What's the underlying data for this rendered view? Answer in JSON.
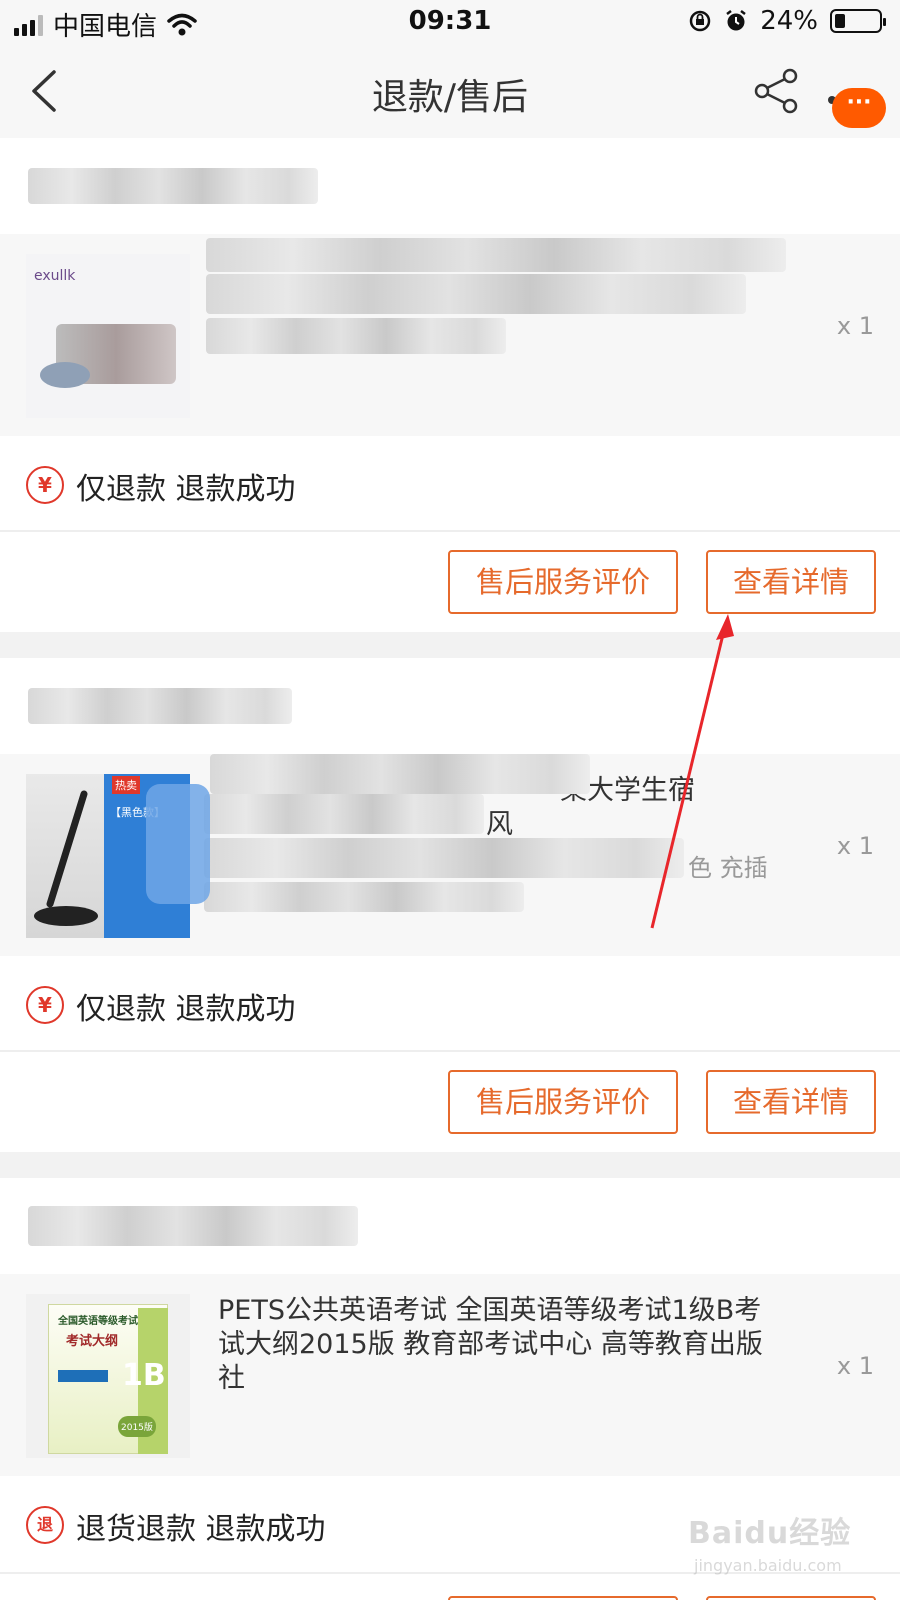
{
  "status_bar": {
    "carrier": "中国电信",
    "time": "09:31",
    "battery": "24%",
    "battery_level": 0.24,
    "icons": [
      "signal-icon",
      "wifi-icon",
      "rotation-lock-icon",
      "alarm-icon",
      "battery-icon"
    ]
  },
  "nav": {
    "title": "退款/售后",
    "message_badge": "···",
    "icons": [
      "back-icon",
      "share-icon",
      "more-icon"
    ]
  },
  "orders": [
    {
      "product_name": "",
      "product_spec": "",
      "thumb_brand": "exullk",
      "qty": "x 1",
      "status_icon": "¥",
      "status": "仅退款 退款成功",
      "review_label": "售后服务评价",
      "detail_label": "查看详情"
    },
    {
      "product_name": "桌大学生宿",
      "product_name_line2": "风",
      "product_spec": "色 充插",
      "thumb_badge": "热卖",
      "thumb_label": "【黑色款】",
      "qty": "x 1",
      "status_icon": "¥",
      "status": "仅退款 退款成功",
      "review_label": "售后服务评价",
      "detail_label": "查看详情"
    },
    {
      "product_name": "PETS公共英语考试 全国英语等级考试1级B考试大纲2015版 教育部考试中心 高等教育出版社",
      "thumb_line1": "全国英语等级考试",
      "thumb_line2": "考试大纲",
      "thumb_level": "1B",
      "thumb_year": "2015版",
      "qty": "x 1",
      "status_icon": "退",
      "status": "退货退款 退款成功"
    }
  ],
  "watermark": {
    "brand": "Baidu经验",
    "url": "jingyan.baidu.com"
  },
  "colors": {
    "accent": "#e66a2c",
    "status_red": "#e0382b",
    "badge_orange": "#ff5a00",
    "arrow_red": "#e8262b"
  }
}
